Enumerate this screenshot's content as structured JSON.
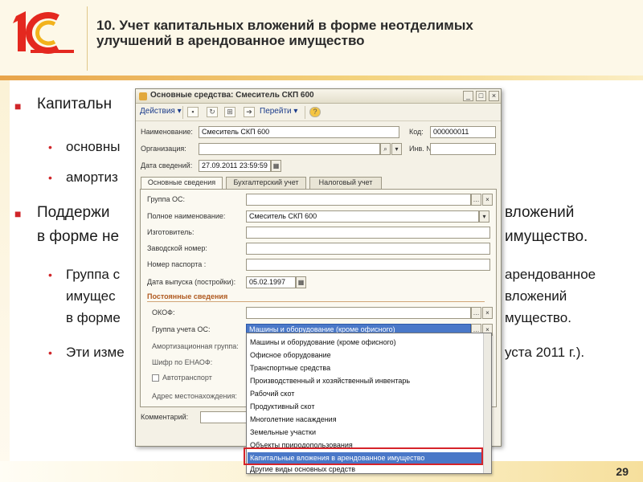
{
  "slide": {
    "title": "10. Учет капитальных вложений в форме неотделимых улучшений в арендованное имущество",
    "page_number": "29",
    "bullets": [
      {
        "text": "Капитальн",
        "level": 1
      },
      {
        "text": "основны",
        "level": 2
      },
      {
        "text": "амортиз",
        "level": 2
      },
      {
        "text": "Поддержи",
        "level": 1
      },
      {
        "text": "в форме не",
        "level": 1,
        "continuation": true
      },
      {
        "text": "Группа с",
        "level": 2
      },
      {
        "text": "имущес",
        "level": 2,
        "continuation": true
      },
      {
        "text": "в форме",
        "level": 2,
        "continuation": true
      },
      {
        "text": "Эти изме",
        "level": 2
      }
    ],
    "bullets_right": [
      "вложений",
      "имущество.",
      "арендованное",
      "вложений",
      "мущество.",
      "уста 2011 г.)."
    ],
    "accent_color": "#d0262a"
  },
  "window": {
    "title": "Основные средства: Смеситель СКП 600",
    "toolbar": {
      "actions_label": "Действия",
      "goto_label": "Перейти",
      "help_label": "?"
    },
    "fields": {
      "name_label": "Наименование:",
      "name_value": "Смеситель СКП 600",
      "code_label": "Код:",
      "code_value": "000000011",
      "org_label": "Организация:",
      "org_value": "",
      "inv_label": "Инв. №:",
      "inv_value": "",
      "date_label": "Дата сведений:",
      "date_value": "27.09.2011 23:59:59"
    },
    "tabs": [
      "Основные сведения",
      "Бухгалтерский учет",
      "Налоговый учет"
    ],
    "active_tab": 0,
    "main": {
      "group_label": "Группа ОС:",
      "group_value": "",
      "fullname_label": "Полное наименование:",
      "fullname_value": "Смеситель СКП 600",
      "maker_label": "Изготовитель:",
      "serial_label": "Заводской номер:",
      "passport_label": "Номер паспорта :",
      "release_label": "Дата выпуска (постройки):",
      "release_value": "05.02.1997"
    },
    "permanent": {
      "section_label": "Постоянные сведения",
      "okof_label": "ОКОФ:",
      "okof_value": "",
      "group_acc_label": "Группа учета ОС:",
      "group_acc_value": "Машины и оборудование (кроме офисного)",
      "amort_label": "Амортизационная группа:",
      "enaof_label": "Шифр по ЕНАОФ:",
      "auto_label": "Автотранспорт",
      "address_label": "Адрес местонахождения:"
    },
    "comment_label": "Комментарий:",
    "dropdown_items": [
      "Машины и оборудование (кроме офисного)",
      "Офисное оборудование",
      "Транспортные средства",
      "Производственный и хозяйственный инвентарь",
      "Рабочий скот",
      "Продуктивный скот",
      "Многолетние насаждения",
      "Земельные участки",
      "Объекты природопользования",
      "Капитальные вложения в арендованное имущество",
      "Другие виды основных средств"
    ],
    "selected_item_index": 9
  }
}
